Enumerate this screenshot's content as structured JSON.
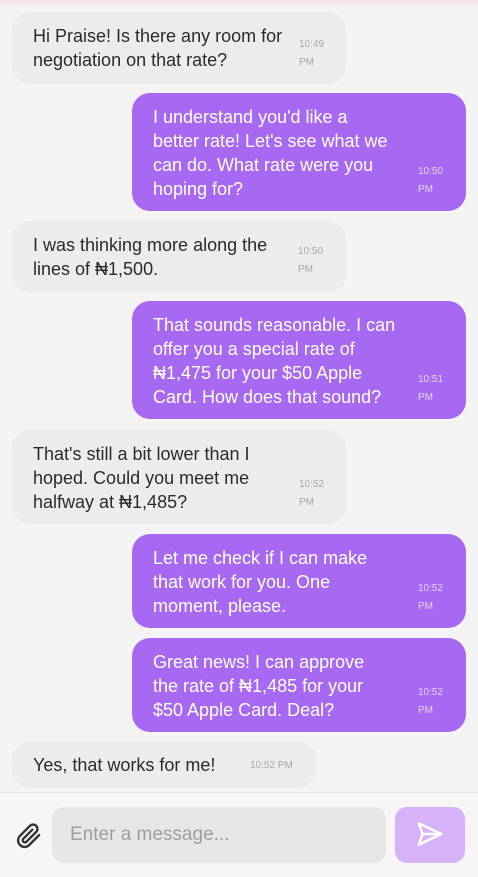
{
  "messages": [
    {
      "direction": "in",
      "text": "Hi Praise! Is there any room for negotiation on that rate?",
      "time": "10:49\nPM"
    },
    {
      "direction": "out",
      "text": "I understand you'd like a better rate! Let's see what we can do. What rate were you hoping for?",
      "time": "10:50\nPM"
    },
    {
      "direction": "in",
      "text": "I was thinking more along the lines of ₦1,500.",
      "time": "10:50\nPM"
    },
    {
      "direction": "out",
      "text": "That sounds reasonable. I can offer you a special rate of ₦1,475 for your $50 Apple Card. How does that sound?",
      "time": "10:51\nPM"
    },
    {
      "direction": "in",
      "text": "That's still a bit lower than I hoped. Could you meet me halfway at ₦1,485?",
      "time": "10:52\nPM"
    },
    {
      "direction": "out",
      "text": "Let me check if I can make that work for you. One moment, please.",
      "time": "10:52\nPM"
    },
    {
      "direction": "out",
      "text": "Great news! I can approve the rate of ₦1,485 for your $50 Apple Card. Deal?",
      "time": "10:52\nPM"
    },
    {
      "direction": "in",
      "text": "Yes, that works for me!",
      "time": "10:52 PM"
    }
  ],
  "composer": {
    "placeholder": "Enter a message...",
    "attach_icon": "paperclip-icon",
    "send_icon": "send-icon"
  },
  "colors": {
    "incoming_bubble": "#ececec",
    "outgoing_bubble": "#a768f2",
    "send_button": "#d8b2f8",
    "background": "#f4f4f5"
  }
}
